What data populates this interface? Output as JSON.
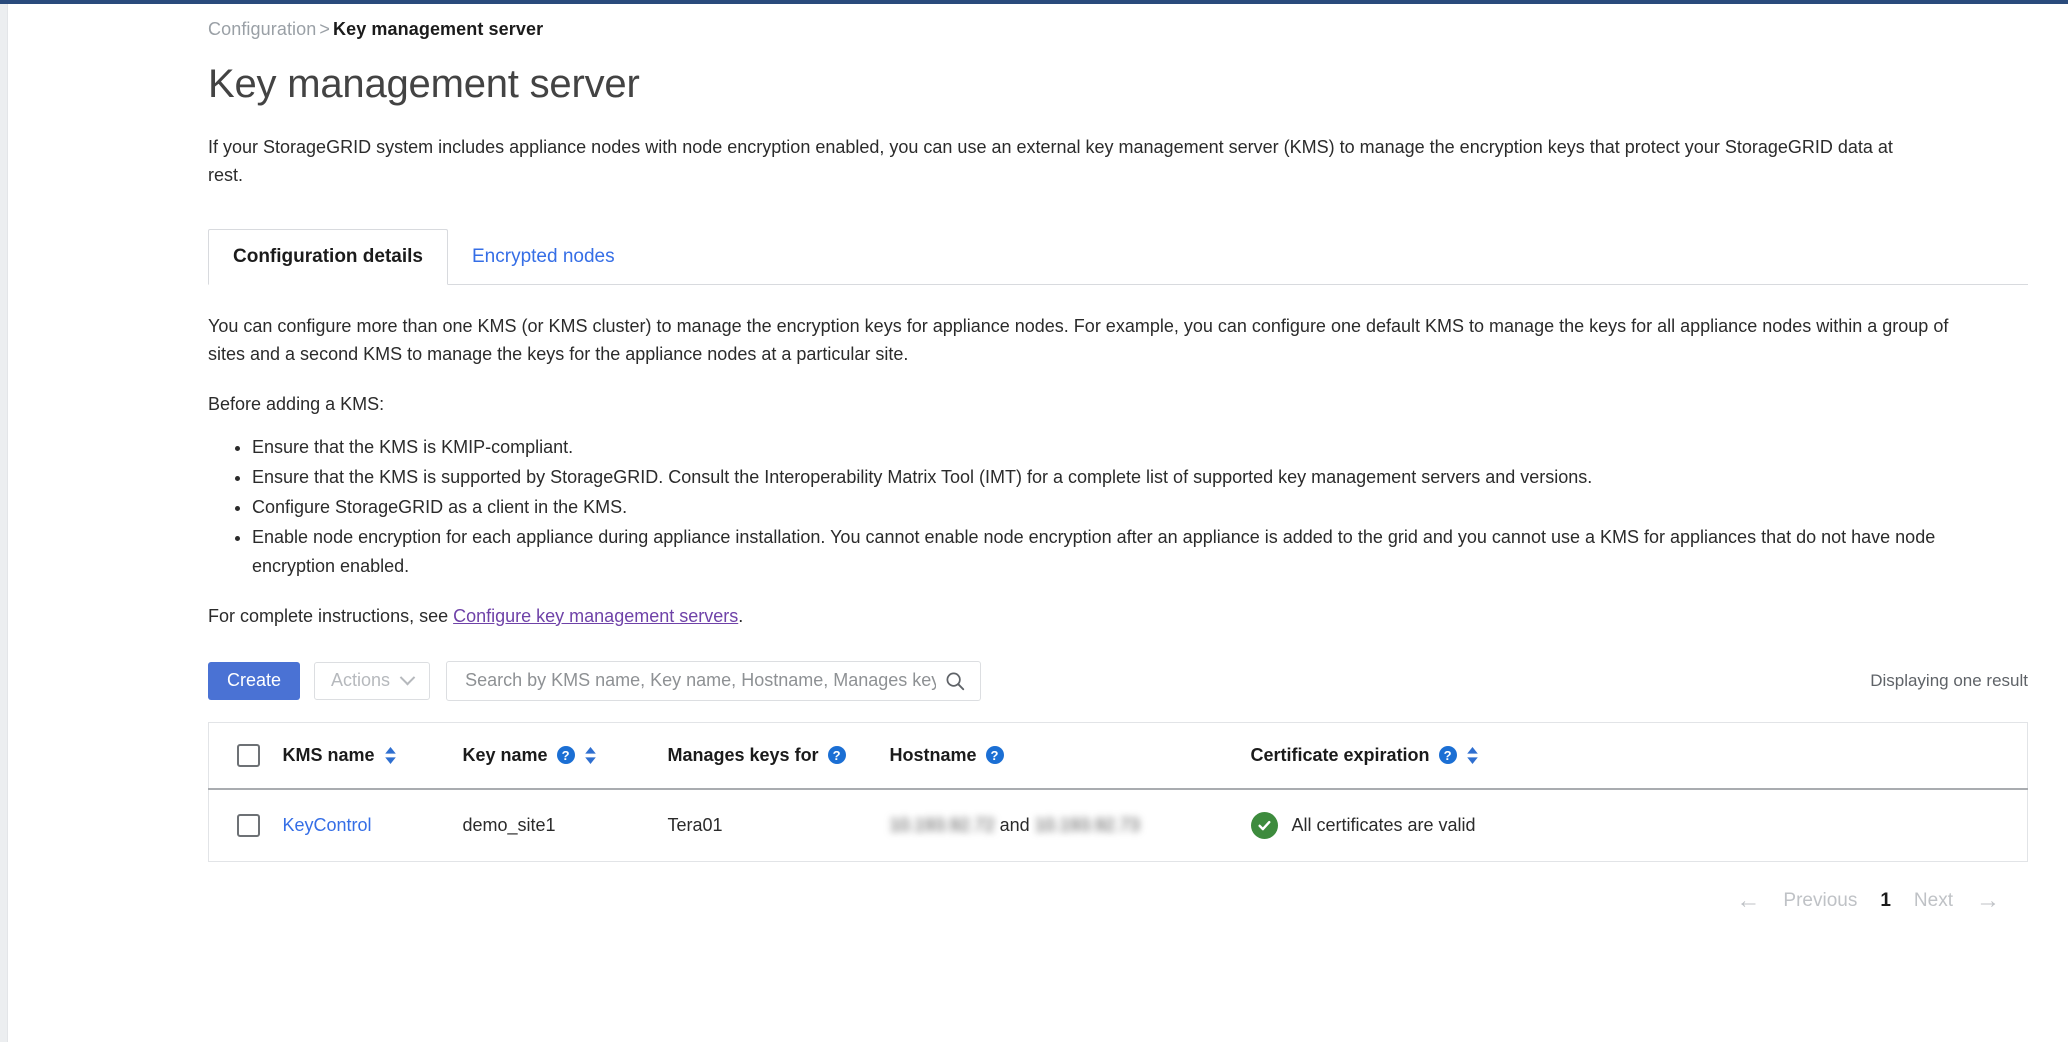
{
  "breadcrumb": {
    "root": "Configuration",
    "separator": ">",
    "current": "Key management server"
  },
  "page_title": "Key management server",
  "intro": "If your StorageGRID system includes appliance nodes with node encryption enabled, you can use an external key management server (KMS) to manage the encryption keys that protect your StorageGRID data at rest.",
  "tabs": [
    {
      "label": "Configuration details",
      "active": true
    },
    {
      "label": "Encrypted nodes",
      "active": false
    }
  ],
  "content": {
    "paragraph1": "You can configure more than one KMS (or KMS cluster) to manage the encryption keys for appliance nodes. For example, you can configure one default KMS to manage the keys for all appliance nodes within a group of sites and a second KMS to manage the keys for the appliance nodes at a particular site.",
    "paragraph2": "Before adding a KMS:",
    "bullets": [
      "Ensure that the KMS is KMIP-compliant.",
      "Ensure that the KMS is supported by StorageGRID. Consult the Interoperability Matrix Tool (IMT) for a complete list of supported key management servers and versions.",
      "Configure StorageGRID as a client in the KMS.",
      "Enable node encryption for each appliance during appliance installation. You cannot enable node encryption after an appliance is added to the grid and you cannot use a KMS for appliances that do not have node encryption enabled."
    ],
    "instructions_prefix": "For complete instructions, see ",
    "instructions_link": "Configure key management servers",
    "instructions_suffix": "."
  },
  "toolbar": {
    "create_label": "Create",
    "actions_label": "Actions",
    "search_placeholder": "Search by KMS name, Key name, Hostname, Manages keys for",
    "search_value": "",
    "result_count": "Displaying one result"
  },
  "table": {
    "columns": [
      {
        "key": "select",
        "label": "",
        "help": false,
        "sortable": false
      },
      {
        "key": "kms",
        "label": "KMS name",
        "help": false,
        "sortable": true
      },
      {
        "key": "keyname",
        "label": "Key name",
        "help": true,
        "sortable": true
      },
      {
        "key": "manages",
        "label": "Manages keys for",
        "help": true,
        "sortable": false
      },
      {
        "key": "host",
        "label": "Hostname",
        "help": true,
        "sortable": false
      },
      {
        "key": "cert",
        "label": "Certificate expiration",
        "help": true,
        "sortable": true
      }
    ],
    "rows": [
      {
        "kms_name": "KeyControl",
        "key_name": "demo_site1",
        "manages_keys_for": "Tera01",
        "hostname_first": "10.193.92.72",
        "hostname_conjunction": "and",
        "hostname_second": "10.193.92.73",
        "certificate_status": "All certificates are valid"
      }
    ]
  },
  "pagination": {
    "previous_label": "Previous",
    "current_page": "1",
    "next_label": "Next",
    "prev_arrow": "←",
    "next_arrow": "→"
  },
  "colors": {
    "primary_button": "#4a72d4",
    "link": "#356ee6",
    "visited_link": "#6f42a8",
    "help_icon": "#1b6fd4",
    "success": "#3d8b3d",
    "top_bar": "#2a4b7c"
  }
}
